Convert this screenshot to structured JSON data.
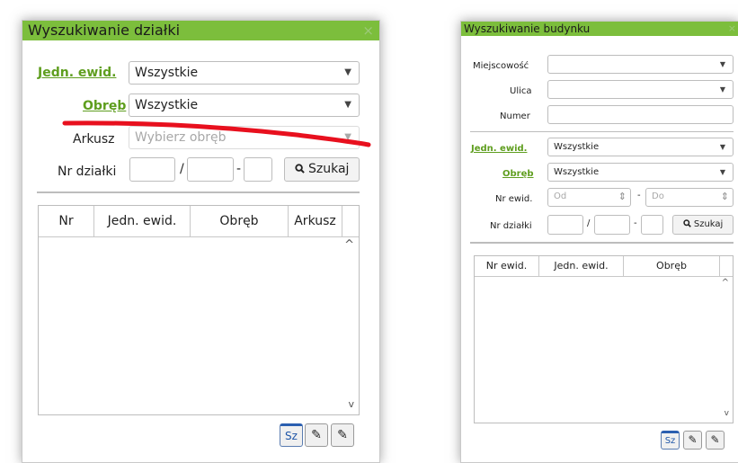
{
  "parcel_search": {
    "title": "Wyszukiwanie działki",
    "close_glyph": "×",
    "jedn_label": "Jedn. ewid.",
    "jedn_value": "Wszystkie",
    "obreb_label": "Obręb",
    "obreb_value": "Wszystkie",
    "arkusz_label": "Arkusz",
    "arkusz_placeholder": "Wybierz obręb",
    "nr_dzialki_label": "Nr działki",
    "slash": "/",
    "dash": "-",
    "search_button": "Szukaj",
    "columns": [
      "Nr",
      "Jedn. ewid.",
      "Obręb",
      "Arkusz"
    ],
    "footer_buttons": [
      "Sz",
      "✎",
      "✎"
    ]
  },
  "building_search": {
    "title": "Wyszukiwanie budynku",
    "close_glyph": "×",
    "miejscowosc_label": "Miejscowość",
    "ulica_label": "Ulica",
    "numer_label": "Numer",
    "jedn_label": "Jedn. ewid.",
    "jedn_value": "Wszystkie",
    "obreb_label": "Obręb",
    "obreb_value": "Wszystkie",
    "nr_ewid_label": "Nr ewid.",
    "od_placeholder": "Od",
    "do_placeholder": "Do",
    "nr_dzialki_label": "Nr działki",
    "slash": "/",
    "dash": "-",
    "search_button": "Szukaj",
    "columns": [
      "Nr ewid.",
      "Jedn. ewid.",
      "Obręb"
    ],
    "footer_buttons": [
      "Sz",
      "✎",
      "✎"
    ]
  },
  "icons": {
    "dropdown": "▼",
    "search": "🔍",
    "scroll_up": "^",
    "scroll_down": "v",
    "stepper": "⇕"
  },
  "colors": {
    "title_bar": "#7cbe3c",
    "link_label": "#5f9e1f",
    "annotation_line": "#e8101e"
  }
}
